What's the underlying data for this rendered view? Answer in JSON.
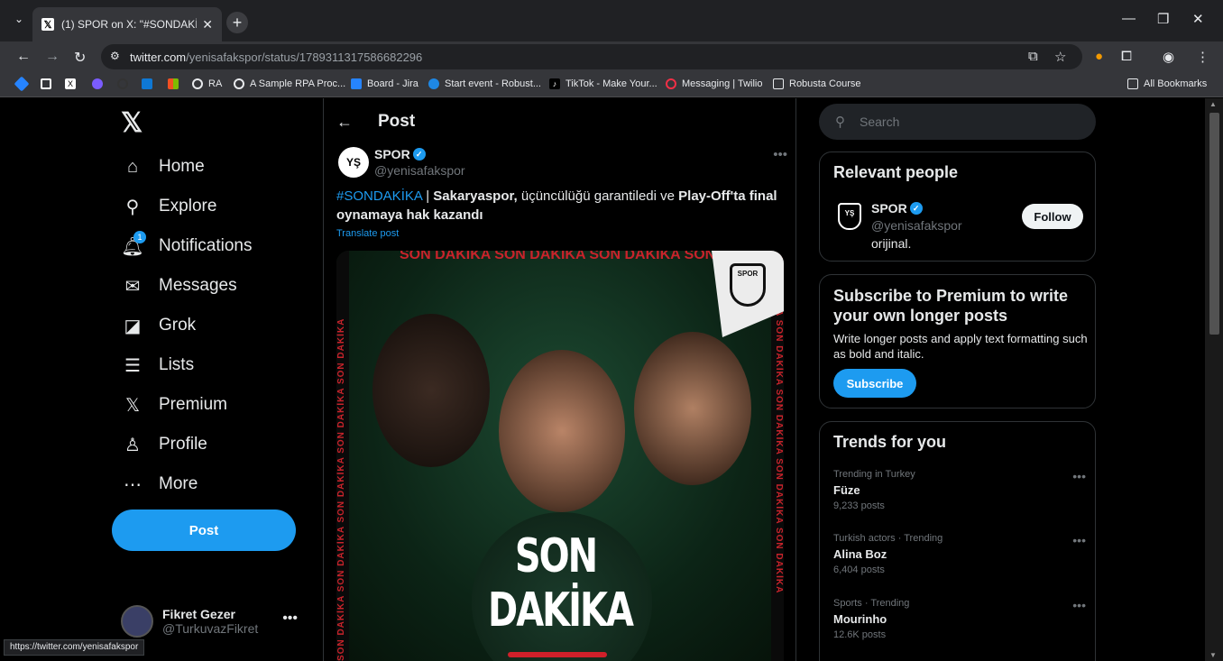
{
  "browser": {
    "tab_title": "(1) SPOR on X: \"#SONDAKİKA |",
    "tab_favicon": "x-logo",
    "url_site": "twitter.com",
    "url_path": "/yenisafakspor/status/1789311317586682296",
    "status_url": "https://twitter.com/yenisafakspor"
  },
  "bookmarks": [
    {
      "label": "",
      "icon": "jira-diamond",
      "color": "#2684ff"
    },
    {
      "label": "",
      "icon": "square",
      "color": "#ffffff"
    },
    {
      "label": "",
      "icon": "x-logo",
      "color": "#ffffff"
    },
    {
      "label": "",
      "icon": "hexagon",
      "color": "#7b5cff"
    },
    {
      "label": "",
      "icon": "circle",
      "color": "#333333"
    },
    {
      "label": "",
      "icon": "outlook",
      "color": "#0f78d4"
    },
    {
      "label": "",
      "icon": "microsoft",
      "color": "#f25022"
    },
    {
      "label": "RA",
      "icon": "globe",
      "color": "#e8eaed"
    },
    {
      "label": "A Sample RPA Proc...",
      "icon": "globe",
      "color": "#e8eaed"
    },
    {
      "label": "Board - Jira",
      "icon": "jira",
      "color": "#2684ff"
    },
    {
      "label": "Start event - Robust...",
      "icon": "cloud",
      "color": "#1e88e5"
    },
    {
      "label": "TikTok - Make Your...",
      "icon": "tiktok",
      "color": "#000000"
    },
    {
      "label": "Messaging | Twilio",
      "icon": "twilio",
      "color": "#f22f46"
    },
    {
      "label": "Robusta Course",
      "icon": "folder",
      "color": "#e8eaed"
    },
    {
      "label": "All Bookmarks",
      "icon": "folder",
      "color": "#e8eaed"
    }
  ],
  "sidebar": {
    "items": [
      {
        "label": "Home",
        "icon": "home-icon"
      },
      {
        "label": "Explore",
        "icon": "search-icon"
      },
      {
        "label": "Notifications",
        "icon": "bell-icon",
        "badge": "1"
      },
      {
        "label": "Messages",
        "icon": "envelope-icon"
      },
      {
        "label": "Grok",
        "icon": "grok-icon"
      },
      {
        "label": "Lists",
        "icon": "list-icon"
      },
      {
        "label": "Premium",
        "icon": "x-icon"
      },
      {
        "label": "Profile",
        "icon": "person-icon"
      },
      {
        "label": "More",
        "icon": "more-circle-icon"
      }
    ],
    "post_button": "Post",
    "user": {
      "name": "Fikret Gezer",
      "handle": "@TurkuvazFikret"
    }
  },
  "main": {
    "header": "Post",
    "author": {
      "name": "SPOR",
      "handle": "@yenisafakspor"
    },
    "tweet": {
      "hashtag": "#SONDAKİKA",
      "sep": " | ",
      "bold1": "Sakaryaspor,",
      "mid": " üçüncülüğü garantiledi ve ",
      "bold2": "Play-Off'ta final oynamaya hak kazandı"
    },
    "translate": "Translate post",
    "media": {
      "headline": "SON DAKİKA",
      "repeat_text": "SON DAKİKA SON DAKİKA SON DAKİKA SON DAKİKA SON DAKİKA",
      "seal_text": "SPOR"
    }
  },
  "right": {
    "search_placeholder": "Search",
    "relevant": {
      "title": "Relevant people",
      "name": "SPOR",
      "handle": "@yenisafakspor",
      "bio": "orijinal.",
      "follow": "Follow"
    },
    "premium": {
      "title": "Subscribe to Premium to write your own longer posts",
      "body": "Write longer posts and apply text formatting such as bold and italic.",
      "button": "Subscribe"
    },
    "trends": {
      "title": "Trends for you",
      "items": [
        {
          "context": "Trending in Turkey",
          "name": "Füze",
          "count": "9,233 posts"
        },
        {
          "context": "Turkish actors · Trending",
          "name": "Alina Boz",
          "count": "6,404 posts"
        },
        {
          "context": "Sports · Trending",
          "name": "Mourinho",
          "count": "12.6K posts"
        }
      ]
    }
  }
}
